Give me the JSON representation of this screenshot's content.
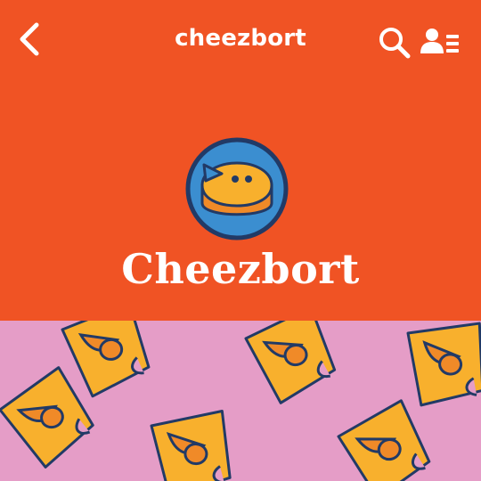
{
  "topbar": {
    "title": "cheezbort",
    "back_icon": "chevron-left-icon",
    "search_icon": "search-icon",
    "members_icon": "member-list-icon"
  },
  "profile": {
    "name": "Cheezbort",
    "avatar_icon": "cheese-wheel-avatar-icon"
  },
  "colors": {
    "header_bg": "#f05324",
    "banner_bg": "#e59dc7",
    "cheese": "#f8b02d",
    "cheese_dark": "#f08a28",
    "outline": "#223a66",
    "avatar_ring": "#3b8ed0"
  }
}
